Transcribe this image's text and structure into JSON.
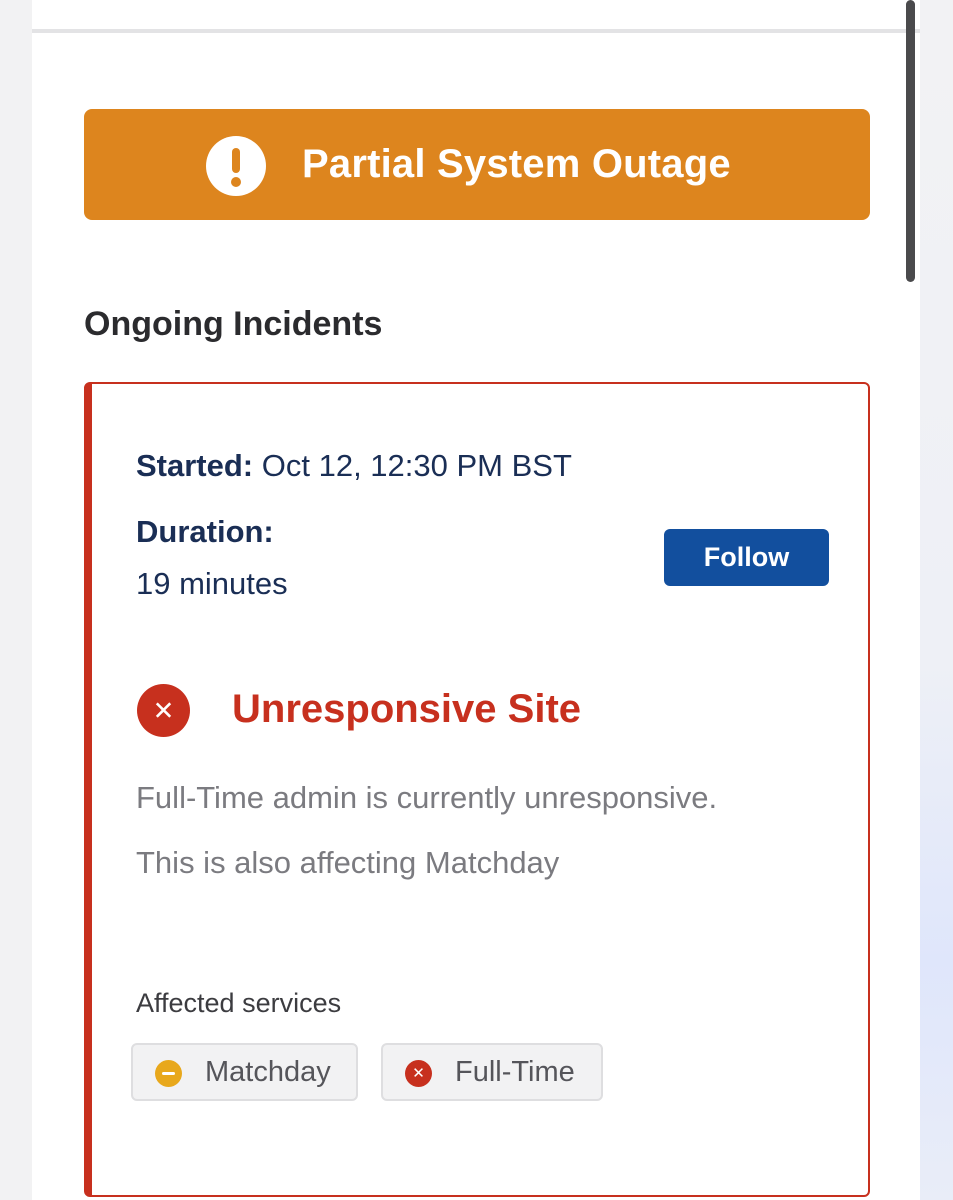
{
  "status_banner": {
    "title": "Partial System Outage",
    "icon": "exclamation-circle-icon",
    "color": "#dd851e"
  },
  "section": {
    "title": "Ongoing Incidents"
  },
  "incident": {
    "started_label": "Started:",
    "started_value": "Oct 12, 12:30 PM BST",
    "duration_label": "Duration:",
    "duration_value": "19 minutes",
    "follow_label": "Follow",
    "title": "Unresponsive Site",
    "icon": "x-circle-icon",
    "status_color": "#c7301e",
    "description": [
      "Full-Time admin is currently unresponsive.",
      "This is also affecting Matchday"
    ],
    "affected_label": "Affected services",
    "affected_services": [
      {
        "name": "Matchday",
        "icon": "minus-circle-icon",
        "color": "#e8a81c"
      },
      {
        "name": "Full-Time",
        "icon": "x-circle-icon",
        "color": "#c7301e"
      }
    ]
  },
  "colors": {
    "follow_button": "#124f9e",
    "meta_text": "#1a2e55"
  }
}
